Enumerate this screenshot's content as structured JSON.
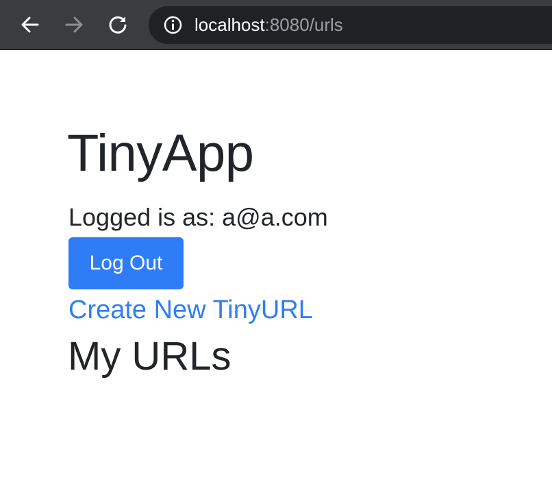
{
  "browser": {
    "url_host": "localhost",
    "url_rest": ":8080/urls",
    "icons": {
      "back": "arrow-left-icon",
      "forward": "arrow-right-icon",
      "reload": "reload-icon",
      "info": "info-icon"
    }
  },
  "page": {
    "title": "TinyApp",
    "logged_in_text": "Logged is as: a@a.com",
    "logout_label": "Log Out",
    "create_link_text": "Create New TinyURL",
    "section_title": "My URLs"
  },
  "colors": {
    "primary": "#2f7df6",
    "text": "#212529",
    "toolbar": "#3b3c3e",
    "omnibox": "#202124"
  }
}
